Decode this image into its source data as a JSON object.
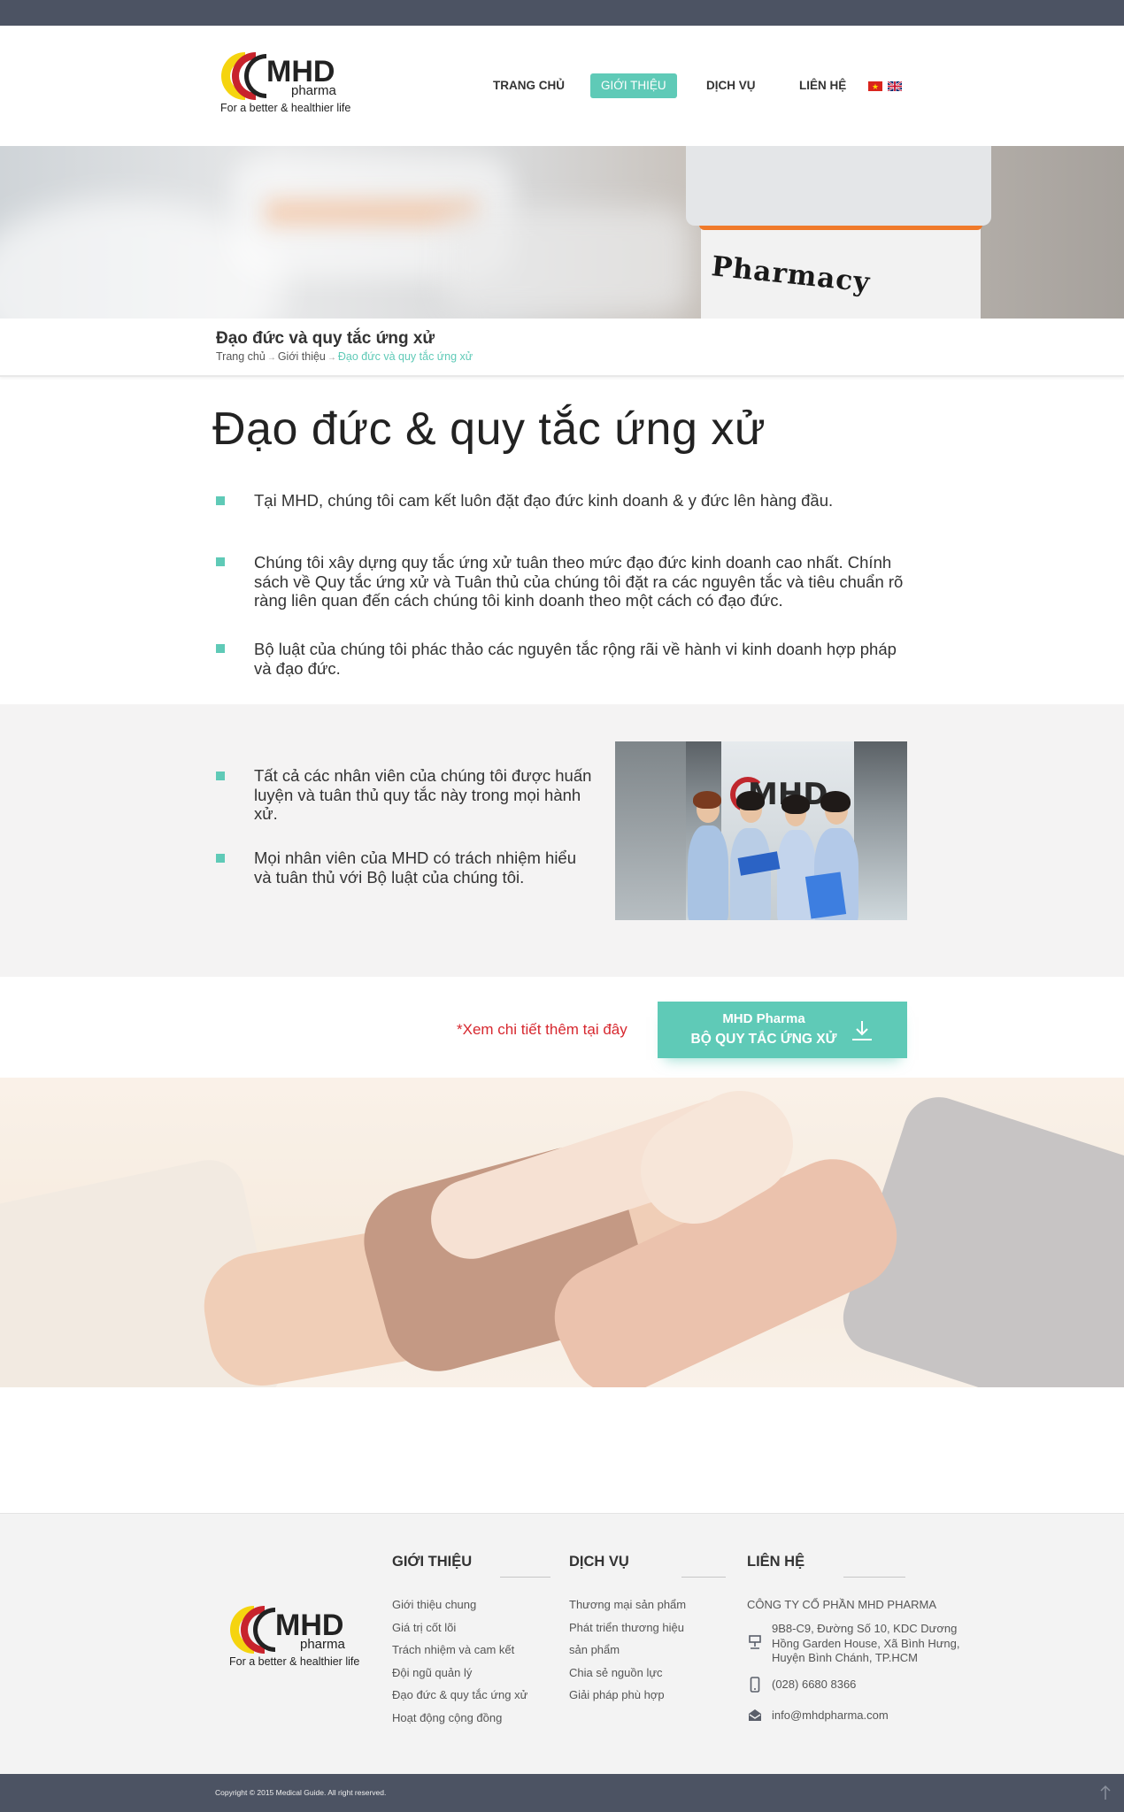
{
  "brand": {
    "name": "MHD",
    "sub": "pharma",
    "tagline": "For a better & healthier life",
    "colors": {
      "accent": "#5fcab7",
      "dark_bar": "#4c5363",
      "logo_yellow": "#f5d40f",
      "logo_red": "#c8232c",
      "cta_note": "#d7282f"
    }
  },
  "nav": {
    "items": [
      {
        "label": "TRANG CHỦ"
      },
      {
        "label": "GIỚI THIỆU",
        "active": true
      },
      {
        "label": "DỊCH VỤ"
      },
      {
        "label": "LIÊN HỆ"
      }
    ],
    "languages": [
      "vi-flag-icon",
      "uk-flag-icon"
    ]
  },
  "hero": {
    "text": "Pharmacy"
  },
  "page": {
    "subtitle": "Đạo đức và quy tắc ứng xử",
    "breadcrumb": [
      "Trang chủ",
      "Giới thiệu",
      "Đạo đức và quy tắc ứng xử"
    ],
    "title": "Đạo đức & quy tắc ứng xử"
  },
  "content": {
    "points": [
      "Tại MHD, chúng tôi cam kết luôn đặt đạo đức kinh doanh & y đức lên hàng đầu.",
      "Chúng tôi xây dựng quy tắc ứng xử tuân theo mức đạo đức kinh doanh cao nhất. Chính sách về Quy tắc ứng xử và Tuân thủ của chúng tôi đặt ra các nguyên tắc và tiêu chuẩn rõ ràng liên quan đến cách chúng tôi kinh doanh theo một cách có đạo đức.",
      "Bộ luật của chúng tôi phác thảo các nguyên tắc rộng rãi về hành vi kinh doanh hợp pháp và đạo đức."
    ],
    "gray_points": [
      "Tất cả các nhân viên của chúng tôi được huấn luyện và tuân thủ quy tắc này trong mọi hành xử.",
      "Mọi nhân viên của MHD có trách nhiệm hiểu và tuân thủ với Bộ luật của chúng tôi."
    ],
    "photo_sign": "MHD"
  },
  "cta": {
    "note": "*Xem chi tiết thêm tại đây",
    "line1": "MHD Pharma",
    "line2": "BỘ QUY TẮC ỨNG XỬ",
    "icon": "download-icon"
  },
  "footer": {
    "about": {
      "title": "GIỚI THIỆU",
      "links": [
        "Giới thiệu chung",
        "Giá trị cốt lõi",
        "Trách nhiệm và cam kết",
        "Đội ngũ quản lý",
        "Đạo đức & quy tắc ứng xử",
        "Hoạt động cộng đồng"
      ]
    },
    "services": {
      "title": "DỊCH VỤ",
      "links": [
        "Thương mại sản phẩm",
        "Phát triển thương hiệu",
        "sản phẩm",
        "Chia sẻ nguồn lực",
        "Giải pháp phù hợp"
      ]
    },
    "contact": {
      "title": "LIÊN HỆ",
      "company": "CÔNG TY CỔ PHẦN MHD PHARMA",
      "address": [
        "9B8-C9, Đường Số 10, KDC Dương",
        "Hồng Garden House, Xã Bình Hưng,",
        "Huyện Bình Chánh, TP.HCM"
      ],
      "phone": "(028) 6680 8366",
      "email": "info@mhdpharma.com"
    }
  },
  "copyright": "Copyright © 2015 Medical Guide. All right reserved."
}
